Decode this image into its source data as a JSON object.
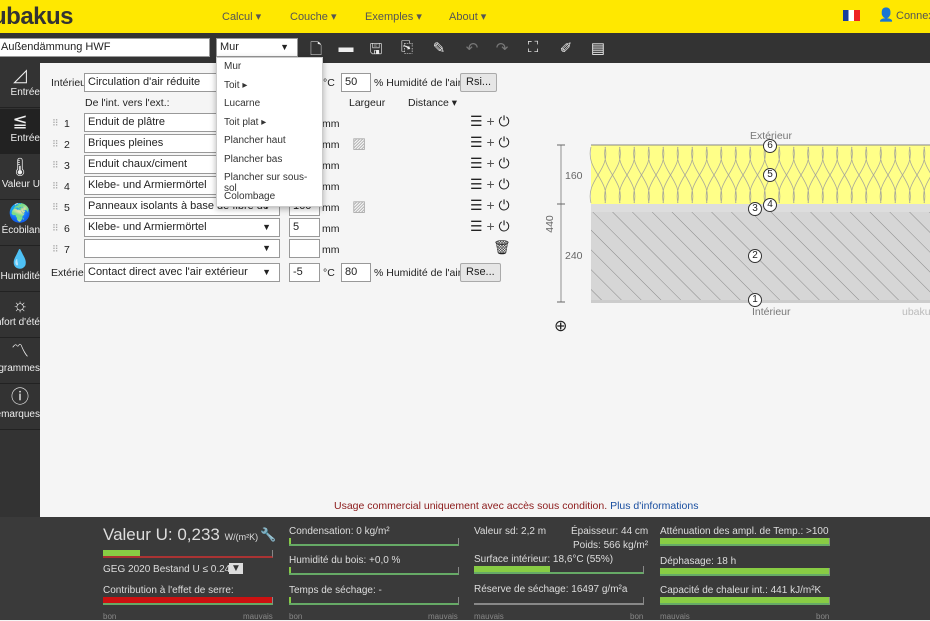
{
  "header": {
    "logo": "ubakus",
    "nav": [
      "Calcul ▾",
      "Couche ▾",
      "Exemples ▾",
      "About ▾"
    ],
    "lang_flag": "fr-flag",
    "login": "Connexion"
  },
  "toolbar": {
    "project_name": "Außendämmung HWF",
    "type_select": "Mur",
    "icons": [
      "new-file-icon",
      "open-folder-icon",
      "save-icon",
      "pdf-icon",
      "edit-icon",
      "undo-icon",
      "redo-icon",
      "fullscreen-icon",
      "brush-icon",
      "comment-icon"
    ]
  },
  "type_menu": [
    "Mur",
    "Toit ▸",
    "Lucarne",
    "Toit plat ▸",
    "Plancher haut",
    "Plancher bas",
    "Plancher sur sous-sol",
    "Colombage"
  ],
  "sidebar": [
    {
      "label": "Entrée",
      "icon": "ruler-icon"
    },
    {
      "label": "Entrée",
      "icon": "layers-icon"
    },
    {
      "label": "Valeur U",
      "icon": "thermometer-icon"
    },
    {
      "label": "Écobilan",
      "icon": "globe-icon"
    },
    {
      "label": "Humidité",
      "icon": "drop-icon"
    },
    {
      "label": "Confort d'été",
      "icon": "sun-icon"
    },
    {
      "label": "Diagrammes",
      "icon": "chart-icon"
    },
    {
      "label": "Remarques",
      "icon": "warning-icon"
    }
  ],
  "interior": {
    "label": "Intérieur",
    "condition": "Circulation d'air réduite",
    "temp_unit": "°C",
    "humidity": "50",
    "humidity_label": "% Humidité de l'air",
    "button": "Rsi..."
  },
  "columns": {
    "direction": "De l'int. vers l'ext.:",
    "thickness": "ur",
    "width": "Largeur",
    "distance": "Distance ▾"
  },
  "layers": [
    {
      "n": "1",
      "material": "Enduit de plâtre",
      "thickness": "",
      "unit": "mm"
    },
    {
      "n": "2",
      "material": "Briques pleines",
      "thickness": "",
      "unit": "mm"
    },
    {
      "n": "3",
      "material": "Enduit chaux/ciment",
      "thickness": "",
      "unit": "mm"
    },
    {
      "n": "4",
      "material": "Klebe- und Armiermörtel",
      "thickness": "",
      "unit": "mm"
    },
    {
      "n": "5",
      "material": "Panneaux isolants à base de fibre de",
      "thickness": "160",
      "unit": "mm"
    },
    {
      "n": "6",
      "material": "Klebe- und Armiermörtel",
      "thickness": "5",
      "unit": "mm"
    },
    {
      "n": "7",
      "material": "",
      "thickness": "",
      "unit": "mm"
    }
  ],
  "exterior": {
    "label": "Extérieur",
    "condition": "Contact direct avec l'air extérieur",
    "temp": "-5",
    "temp_unit": "°C",
    "humidity": "80",
    "humidity_label": "% Humidité de l'air",
    "button": "Rse..."
  },
  "diagram": {
    "top": "Extérieur",
    "bottom": "Intérieur",
    "total": "440",
    "dim1": "160",
    "dim2": "240",
    "watermark": "ubakus"
  },
  "notice": {
    "text": "Usage commercial uniquement avec accès sous condition.",
    "link": "Plus d'informations"
  },
  "results": {
    "u_label": "Valeur U:",
    "u_value": "0,233",
    "u_unit": "W/(m²K)",
    "u_fill": 0.22,
    "standard": "GEG 2020 Bestand U ≤ 0.24",
    "greenhouse": "Contribution à l'effet de serre:",
    "condensation": "Condensation: 0 kg/m²",
    "wood": "Humidité du bois: +0,0 %",
    "drying": "Temps de séchage: -",
    "sd": "Valeur sd: 2,2 m",
    "thickness": "Épaisseur: 44 cm",
    "weight": "Poids: 566 kg/m²",
    "surface": "Surface intérieur: 18,6°C (55%)",
    "surface_fill": 0.45,
    "reserve": "Réserve de séchage: 16497 g/m²a",
    "attenuation": "Atténuation des ampl. de Temp.: >100",
    "phase": "Déphasage: 18 h",
    "capacity": "Capacité de chaleur int.: 441 kJ/m²K",
    "good": "bon",
    "bad": "mauvais"
  },
  "colors": {
    "brand": "#ffe800",
    "insulation": "#ffff88",
    "brick": "#d6d6d6",
    "good_bar": "#8cc84b",
    "bad_bar": "#cc1111"
  }
}
